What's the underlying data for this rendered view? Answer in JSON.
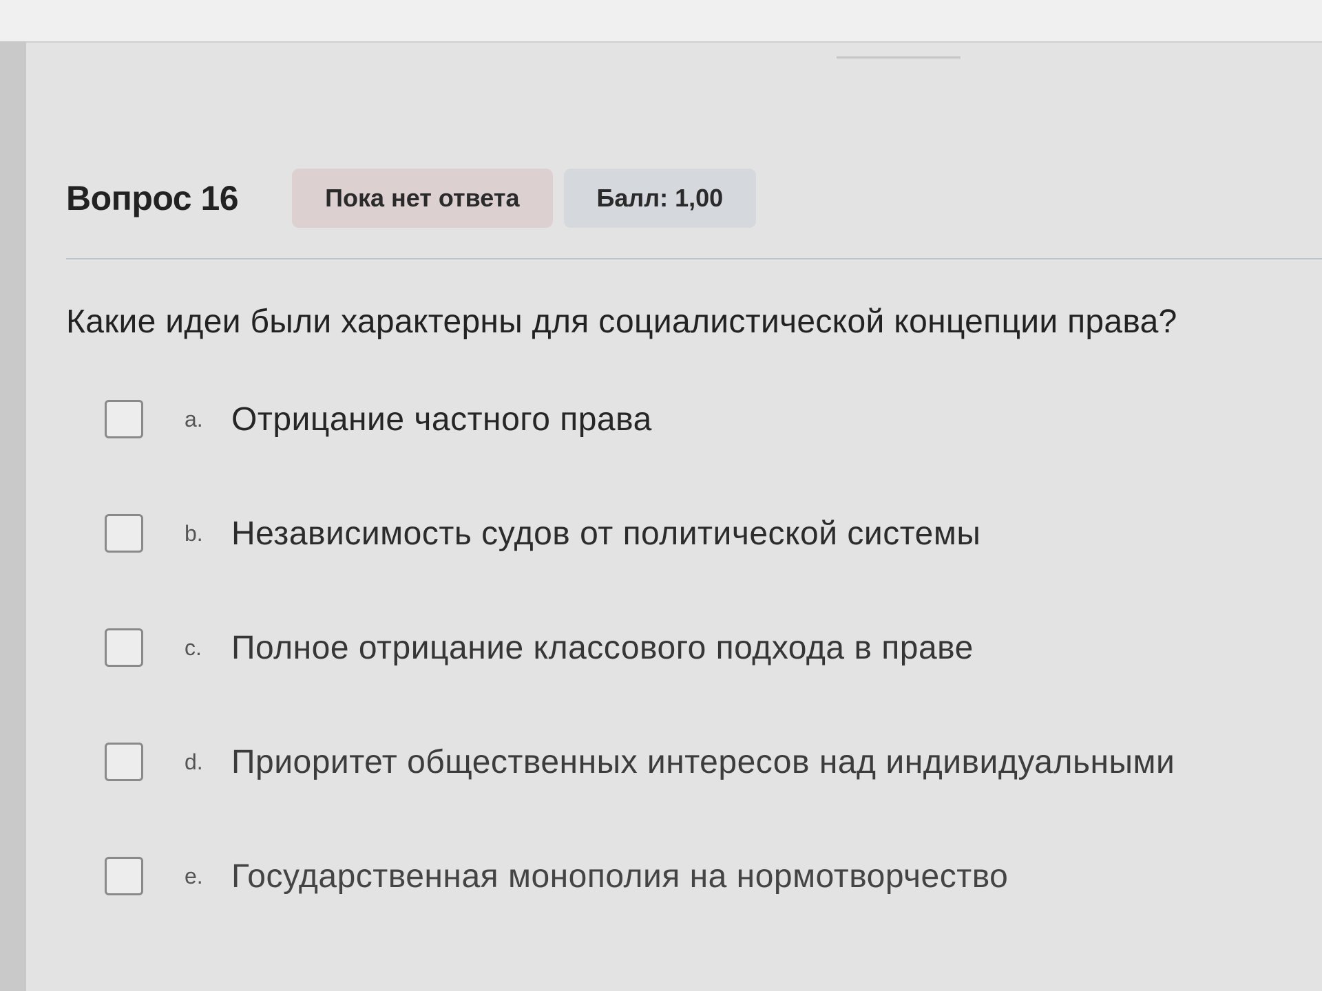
{
  "question_header": {
    "number_label": "Вопрос 16",
    "status_badge": "Пока нет ответа",
    "score_badge": "Балл: 1,00"
  },
  "question": {
    "text": "Какие идеи были характерны для социалистической концепции права?"
  },
  "answers": [
    {
      "letter": "a.",
      "text": "Отрицание частного права",
      "checked": false
    },
    {
      "letter": "b.",
      "text": "Независимость судов от политической системы",
      "checked": false
    },
    {
      "letter": "c.",
      "text": "Полное отрицание классового подхода в праве",
      "checked": false
    },
    {
      "letter": "d.",
      "text": "Приоритет общественных интересов над индивидуальными",
      "checked": false
    },
    {
      "letter": "e.",
      "text": "Государственная монополия на нормотворчество",
      "checked": false
    }
  ],
  "colors": {
    "status_badge_bg": "#dcd0d0",
    "score_badge_bg": "#d5d8dd",
    "divider": "#bcc3cc"
  }
}
